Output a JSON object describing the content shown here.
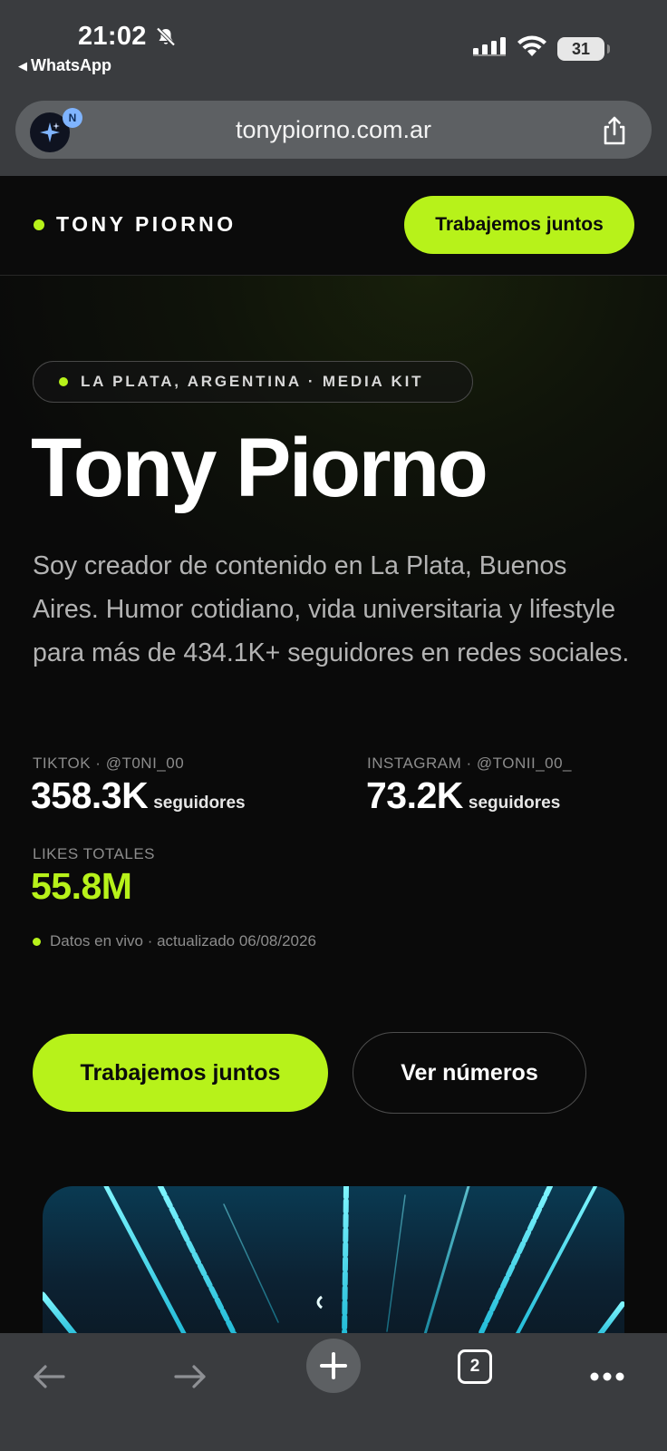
{
  "status_bar": {
    "time": "21:02",
    "back_app": "WhatsApp",
    "battery": "31"
  },
  "browser": {
    "url": "tonypiorno.com.ar",
    "site_badge": "N",
    "open_tabs": "2"
  },
  "site": {
    "brand": "TONY PIORNO",
    "header_cta": "Trabajemos juntos",
    "location_pill": "LA PLATA, ARGENTINA · MEDIA KIT",
    "title": "Tony Piorno",
    "description": "Soy creador de contenido en La Plata, Buenos Aires. Humor cotidiano, vida universitaria y lifestyle para más de 434.1K+ seguidores en redes sociales.",
    "stats": {
      "tiktok": {
        "label": "TIKTOK · @T0NI_00",
        "value": "358.3K",
        "unit": "seguidores"
      },
      "instagram": {
        "label": "INSTAGRAM · @TONII_00_",
        "value": "73.2K",
        "unit": "seguidores"
      },
      "likes": {
        "label": "LIKES TOTALES",
        "value": "55.8M"
      }
    },
    "live_note": "Datos en vivo · actualizado 06/08/2026",
    "primary_cta": "Trabajemos juntos",
    "secondary_cta": "Ver números"
  },
  "colors": {
    "accent": "#b7f21a",
    "chrome": "#3a3c3f",
    "page_bg": "#0a0a0a"
  },
  "icons": [
    "bell-slash-icon",
    "signal-icon",
    "wifi-icon",
    "battery-icon",
    "sparkle-icon",
    "share-icon",
    "back-arrow-icon",
    "forward-arrow-icon",
    "plus-icon",
    "tabs-icon",
    "more-icon"
  ]
}
